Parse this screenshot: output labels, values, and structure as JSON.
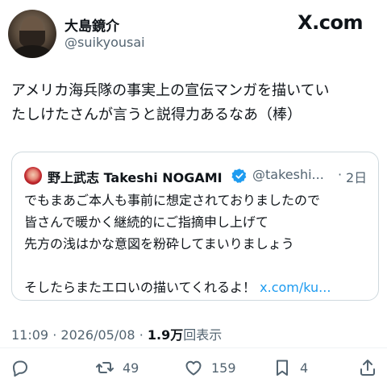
{
  "header": {
    "display_name": "大島鏡介",
    "handle": "@suikyousai",
    "brand": "X.com"
  },
  "tweet": {
    "lines": [
      "アメリカ海兵隊の事実上の宣伝マンガを描いてい",
      "たしけたさんが言うと説得力あるなあ（棒）"
    ]
  },
  "quote": {
    "name": "野上武志 Takeshi NOGAMI",
    "handle": "@takeshi...",
    "separator": "·",
    "time": "2日",
    "lines": [
      "でもまあご本人も事前に想定されておりましたので",
      "皆さんで暖かく継続的にご指摘申し上げて",
      "先方の浅はかな意図を粉砕してまいりましょう"
    ],
    "last_line": "そしたらまたエロいの描いてくれるよ！",
    "link": "x.com/ku..."
  },
  "meta": {
    "time": "11:09",
    "separator": "·",
    "date": "2026/05/08",
    "views_count": "1.9万",
    "views_label": "回表示"
  },
  "actions": {
    "retweets": "49",
    "likes": "159",
    "bookmarks": "4"
  },
  "icons": {
    "reply": "reply-icon",
    "retweet": "retweet-icon",
    "like": "heart-icon",
    "bookmark": "bookmark-icon",
    "share": "share-icon",
    "verified": "verified-badge-icon"
  },
  "colors": {
    "accent": "#1d9bf0",
    "secondary_text": "#536471",
    "text": "#0f1419",
    "border": "#cfd9de"
  }
}
